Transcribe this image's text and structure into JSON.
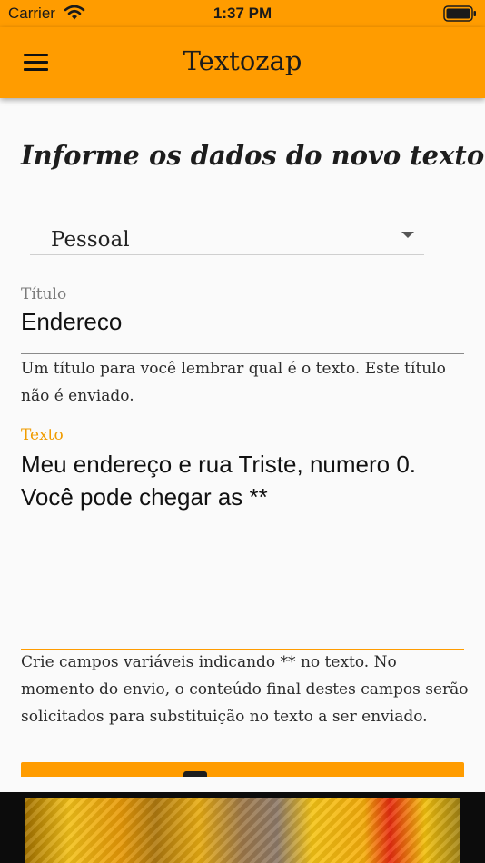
{
  "status_bar": {
    "carrier": "Carrier",
    "time": "1:37 PM",
    "wifi_icon": "wifi-icon",
    "battery_icon": "battery-icon"
  },
  "app_bar": {
    "title": "Textozap",
    "menu_icon": "hamburger-menu-icon"
  },
  "form": {
    "heading": "Informe os dados do novo texto:",
    "category": {
      "selected": "Pessoal",
      "caret_icon": "caret-down-icon"
    },
    "title_field": {
      "label": "Título",
      "value": "Endereco",
      "helper": "Um título para você lembrar qual é o texto. Este título não é enviado."
    },
    "text_field": {
      "label": "Texto",
      "value": "Meu endereço e rua Triste, numero 0. Você pode chegar as **",
      "helper": "Crie campos variáveis indicando ** no texto. No momento do envio, o conteúdo final destes campos serão solicitados para substituição no texto a ser enviado."
    },
    "save_button": {
      "icon": "save-icon"
    }
  },
  "colors": {
    "primary": "#ff9c00",
    "background": "#fafafa",
    "active_label": "#f09c00"
  }
}
